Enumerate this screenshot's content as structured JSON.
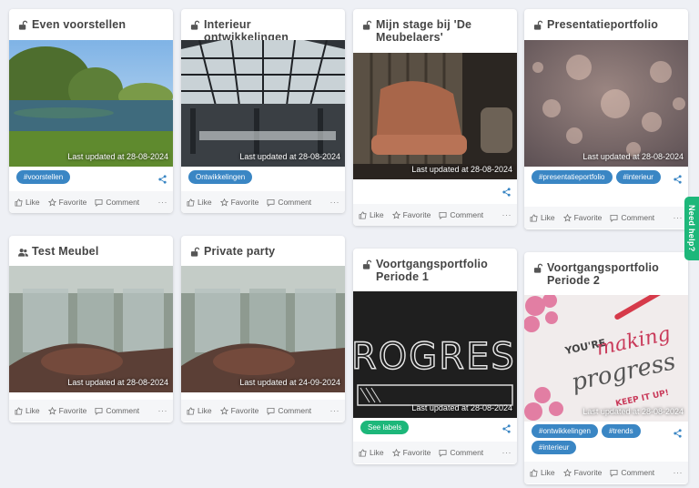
{
  "cards": [
    {
      "title": "Even voorstellen",
      "updated": "Last updated at 28-08-2024",
      "tags": [
        "#voorstellen"
      ]
    },
    {
      "title": "Interieur ontwikkelingen",
      "updated": "Last updated at 28-08-2024",
      "tags": [
        "Ontwikkelingen"
      ]
    },
    {
      "title": "Mijn stage bij 'De Meubelaers'",
      "updated": "Last updated at 28-08-2024",
      "tags": []
    },
    {
      "title": "Presentatieportfolio",
      "updated": "Last updated at 28-08-2024",
      "tags": [
        "#presentatieportfolio",
        "#interieur"
      ]
    },
    {
      "title": "Test Meubel",
      "updated": "Last updated at 28-08-2024",
      "tags": []
    },
    {
      "title": "Private party",
      "updated": "Last updated at 24-09-2024",
      "tags": []
    },
    {
      "title": "Voortgangsportfolio Periode 1",
      "updated": "Last updated at 28-08-2024",
      "tags": [
        "See labels"
      ]
    },
    {
      "title": "Voortgangsportfolio Periode 2",
      "updated": "Last updated at 28-08-2024",
      "tags": [
        "#ontwikkelingen",
        "#trends",
        "#interieur"
      ]
    }
  ],
  "actions": {
    "like": "Like",
    "favorite": "Favorite",
    "comment": "Comment",
    "more": "···"
  },
  "help": "Need help?",
  "thumb_text": {
    "progress": "ROGRESS",
    "making": "YOU'RE",
    "making2": "making",
    "making3": "progress",
    "making4": "KEEP IT UP!"
  },
  "colors": {
    "tag": "#3a86c4",
    "accent": "#1db77a"
  }
}
